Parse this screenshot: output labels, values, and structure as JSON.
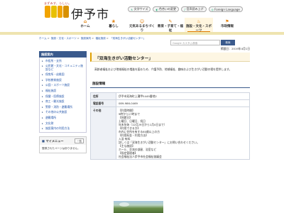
{
  "header": {
    "tagline": "まずみす、らしい。",
    "logo_text": "伊予市",
    "tools": [
      {
        "icon": "♿",
        "label": "文字サイズ"
      },
      {
        "icon": "◐",
        "label": "色合いの変更"
      },
      {
        "icon": "♪",
        "label": "音声読み上げ"
      },
      {
        "icon": "◎",
        "label": "Foreign Language"
      }
    ]
  },
  "nav": [
    {
      "icon": "⌂",
      "label": "ホーム"
    },
    {
      "icon": "❀",
      "label": "暮らし"
    },
    {
      "icon": "☺",
      "label": "元気あるまちづくり"
    },
    {
      "icon": "✎",
      "label": "教育・子育て・福祉"
    },
    {
      "icon": "♨",
      "label": "施設・文化・スポーツ"
    },
    {
      "icon": "⚑",
      "label": "市政情報"
    }
  ],
  "breadcrumb": [
    "ホーム",
    "施設・文化・スポーツ",
    "施設案内",
    "福祉施設",
    "「双海生きがい活動センター」"
  ],
  "search": {
    "placeholder": "Google カスタム検索",
    "button": "検索"
  },
  "sidebar": {
    "title": "施設案内",
    "items": [
      "市役所・支所",
      "公民館・文化・コミュニティ施設など",
      "保育所・幼稚園",
      "学校教育施設",
      "公園・スポーツ施設",
      "福祉施設",
      "保健・医療施設",
      "商工・観光施設",
      "警察・消防・避難場所",
      "その他の公共施設",
      "避難場所",
      "文化財",
      "施設案内の利用方法"
    ]
  },
  "mymenu": {
    "title": "マイメニュー",
    "button": "一覧",
    "body": "登録されたページはありません。"
  },
  "main": {
    "updated": "掲載日：2019年4月1日",
    "title": "「双海生きがい活動センター」",
    "description": "高齢者福祉および地域福祉の増進を図るため、介護予防、地域福祉、趣味および生きがい活動の場を提供します。",
    "section": "施設情報",
    "rows": [
      {
        "label": "住所",
        "lines": [
          "伊予市双海町上灘甲5449番地2"
        ]
      },
      {
        "label": "電話番号",
        "lines": [
          "089-986-0469"
        ]
      },
      {
        "label": "その他",
        "lines": [
          "【利用時間】",
          "9時から17時まで",
          "【休館日】",
          "土曜日、日曜日、祝日",
          "年末年始（12月29日から1月4日まで）",
          "【利用できる方】",
          "市内に住所を有する60歳以上の方",
          "【利用料金・利用方法】",
          "入浴 有料",
          "詳しくは「双海生きがい活動センター」にお問い合わせください。",
          "【主な施設】",
          "ホール、交流の部屋、浴室など",
          "【指定管理者】",
          "社会福祉法人伊予市社会福祉協議会"
        ]
      }
    ]
  },
  "colors": {
    "accent": "#e07a00",
    "nav_blue": "#3a5a8c",
    "bar": "#efe4b0"
  }
}
